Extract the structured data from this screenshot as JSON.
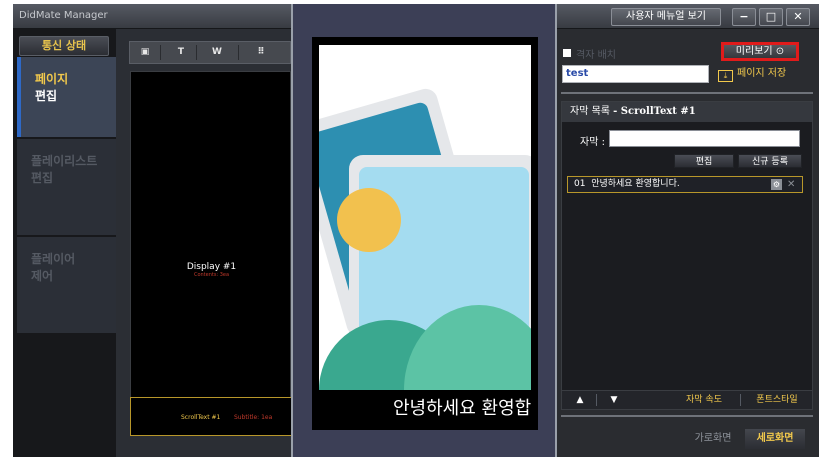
{
  "window": {
    "title": "DidMate Manager",
    "manual_button": "사용자 메뉴얼 보기",
    "controls": [
      "−",
      "□",
      "✕"
    ]
  },
  "left_nav": {
    "status_button": "통신 상태",
    "items": [
      {
        "line1": "페이지",
        "line2": "편집",
        "active": true
      },
      {
        "line1": "플레이리스트",
        "line2": "편집",
        "active": false
      },
      {
        "line1": "플레이어",
        "line2": "제어",
        "active": false
      }
    ]
  },
  "editor": {
    "toolbar": [
      {
        "icon": "image-icon",
        "glyph": "▣"
      },
      {
        "icon": "text-icon",
        "glyph": "T"
      },
      {
        "icon": "web-icon",
        "glyph": "W"
      },
      {
        "icon": "grid-icon",
        "glyph": "⠿"
      }
    ],
    "display_title": "Display #1",
    "display_subtitle": "Contents: 3ea",
    "ticker_name": "ScrollText #1",
    "ticker_subtitle": "Subtitle: 1ea"
  },
  "preview": {
    "scroll_text": "안녕하세요 환영합"
  },
  "right_panel": {
    "grid_label": "격자 배치",
    "grid_checked": false,
    "preview_button": "미리보기",
    "preview_icon": "play-circle-icon",
    "page_name_value": "test",
    "save_button": "페이지 저장",
    "caption_list_title": "자막 목록",
    "caption_list_item": "- ScrollText #1",
    "caption_label": "자막 :",
    "caption_input_value": "",
    "edit_button": "편집",
    "new_button": "신규 등록",
    "captions": [
      {
        "index": "01",
        "text": "안녕하세요 환영합니다."
      }
    ],
    "up_label": "▲",
    "down_label": "▼",
    "speed_button": "자막 속도",
    "font_button": "폰트스타일",
    "landscape_button": "가로화면",
    "portrait_button": "세로화면",
    "highlight_color": "#e01b1b",
    "accent_color": "#f2c94c"
  }
}
